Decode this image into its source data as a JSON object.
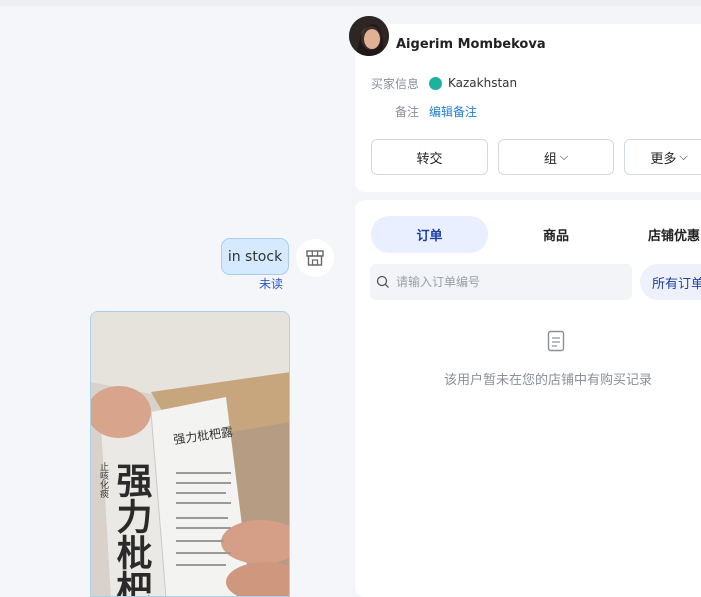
{
  "chat": {
    "message_text": "in stock",
    "read_status": "未读",
    "photo_text": {
      "big": "强力枇杷",
      "small_title": "强力枇杷露",
      "side_text": "止咳化痰"
    }
  },
  "customer": {
    "name": "Aigerim Mombekova",
    "buyer_info_label": "买家信息",
    "country": "Kazakhstan",
    "note_label": "备注",
    "edit_note_label": "编辑备注"
  },
  "actions": {
    "transfer_label": "转交",
    "group_label": "组",
    "more_label": "更多"
  },
  "tabs": [
    {
      "label": "订单",
      "active": true
    },
    {
      "label": "商品",
      "active": false
    },
    {
      "label": "店铺优惠",
      "active": false
    }
  ],
  "orders": {
    "search_placeholder": "请输入订单编号",
    "filter_label": "所有订单",
    "empty_message": "该用户暂未在您的店铺中有购买记录"
  },
  "colors": {
    "accent": "#1d3fa8",
    "link": "#1f7fd4",
    "bubble_bg": "#d6eaff"
  }
}
